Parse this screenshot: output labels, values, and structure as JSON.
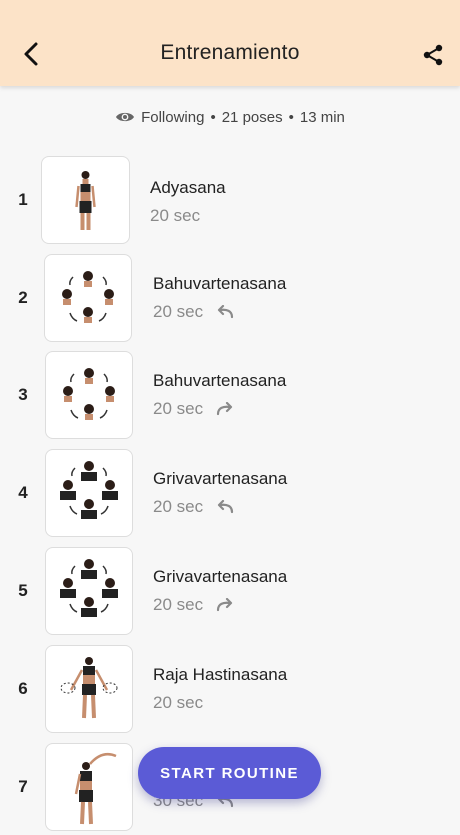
{
  "header": {
    "title": "Entrenamiento",
    "back_icon": "arrow-back-icon",
    "share_icon": "share-icon",
    "background": "#fce3c8"
  },
  "summary": {
    "icon": "eye-icon",
    "mode": "Following",
    "poses": "21 poses",
    "duration": "13 min",
    "separator": "•"
  },
  "poses": [
    {
      "number": "1",
      "name": "Adyasana",
      "duration": "20 sec",
      "direction": "none",
      "thumb": "standing"
    },
    {
      "number": "2",
      "name": "Bahuvartenasana",
      "duration": "20 sec",
      "direction": "counterclockwise",
      "thumb": "heads"
    },
    {
      "number": "3",
      "name": "Bahuvartenasana",
      "duration": "20 sec",
      "direction": "clockwise",
      "thumb": "heads"
    },
    {
      "number": "4",
      "name": "Grivavartenasana",
      "duration": "20 sec",
      "direction": "counterclockwise",
      "thumb": "torsos"
    },
    {
      "number": "5",
      "name": "Grivavartenasana",
      "duration": "20 sec",
      "direction": "clockwise",
      "thumb": "torsos"
    },
    {
      "number": "6",
      "name": "Raja Hastinasana",
      "duration": "20 sec",
      "direction": "none",
      "thumb": "arms-circle"
    },
    {
      "number": "7",
      "name": "",
      "duration": "30 sec",
      "direction": "counterclockwise",
      "thumb": "side-bend"
    }
  ],
  "cta": {
    "label": "START ROUTINE",
    "color": "#5b5bd6"
  }
}
